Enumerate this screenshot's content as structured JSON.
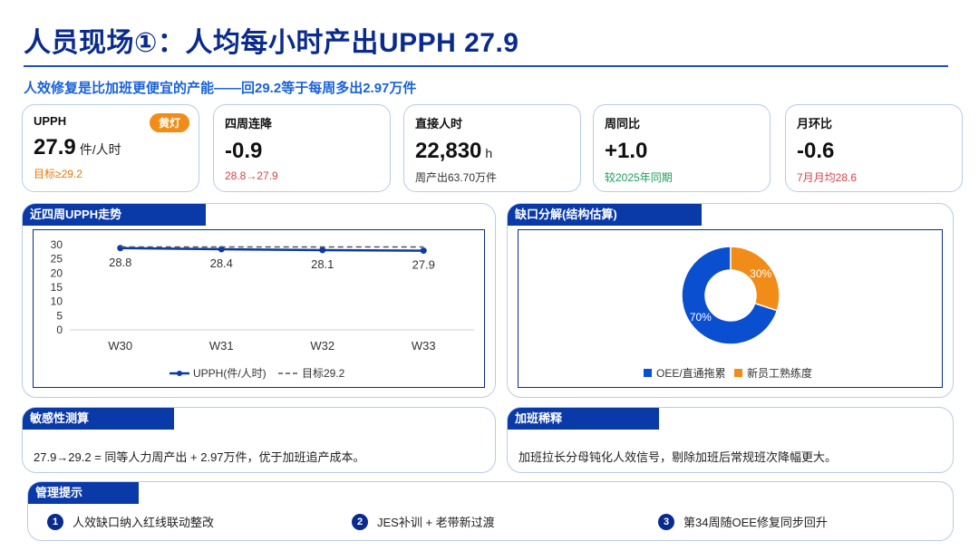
{
  "header": {
    "title": "人员现场①：人均每小时产出UPPH 27.9",
    "subtitle": "人效修复是比加班更便宜的产能——回29.2等于每周多出2.97万件"
  },
  "kpis": [
    {
      "label": "UPPH",
      "value": "27.9",
      "unit": "件/人时",
      "sub": "目标≥29.2",
      "sub_color": "#e07b10",
      "badge": "黄灯",
      "badge_color": "#f28c18"
    },
    {
      "label": "四周连降",
      "value": "-0.9",
      "unit": "",
      "sub": "28.8→27.9",
      "sub_color": "#d0454c"
    },
    {
      "label": "直接人时",
      "value": "22,830",
      "unit": "h",
      "sub": "周产出63.70万件",
      "sub_color": "#333333"
    },
    {
      "label": "周同比",
      "value": "+1.0",
      "unit": "",
      "sub": "较2025年同期",
      "sub_color": "#1e9b5a"
    },
    {
      "label": "月环比",
      "value": "-0.6",
      "unit": "",
      "sub": "7月月均28.6",
      "sub_color": "#d0454c"
    }
  ],
  "trend_panel": {
    "title": "近四周UPPH走势"
  },
  "donut_panel": {
    "title": "缺口分解(结构估算)"
  },
  "sensitivity": {
    "title": "敏感性测算",
    "text": "27.9→29.2 = 同等人力周产出 + 2.97万件，优于加班追产成本。"
  },
  "overtime": {
    "title": "加班稀释",
    "text": "加班拉长分母钝化人效信号，剔除加班后常规班次降幅更大。"
  },
  "tips": {
    "title": "管理提示",
    "items": [
      {
        "num": "1",
        "text": "人效缺口纳入红线联动整改"
      },
      {
        "num": "2",
        "text": "JES补训 + 老带新过渡"
      },
      {
        "num": "3",
        "text": "第34周随OEE修复同步回升"
      }
    ]
  },
  "colors": {
    "primary": "#0a2b8e",
    "accent": "#1a62d6",
    "orange": "#f28c18",
    "donut_blue": "#0a4fd0"
  },
  "chart_data": [
    {
      "type": "line",
      "title": "近四周UPPH走势",
      "categories": [
        "W30",
        "W31",
        "W32",
        "W33"
      ],
      "series": [
        {
          "name": "UPPH(件/人时)",
          "values": [
            28.8,
            28.4,
            28.1,
            27.9
          ],
          "color": "#0a3aa8",
          "style": "solid"
        },
        {
          "name": "目标29.2",
          "values": [
            29.2,
            29.2,
            29.2,
            29.2
          ],
          "color": "#555555",
          "style": "dashed"
        }
      ],
      "ylim": [
        0,
        30
      ],
      "yticks": [
        "0",
        "5",
        "10",
        "15",
        "20",
        "25",
        "30"
      ],
      "data_labels": [
        "28.8",
        "28.4",
        "28.1",
        "27.9"
      ],
      "legend_position": "bottom",
      "grid": false
    },
    {
      "type": "pie",
      "title": "缺口分解(结构估算)",
      "donut": true,
      "labels": [
        "OEE/直通拖累",
        "新员工熟练度"
      ],
      "values": [
        70,
        30
      ],
      "value_labels": [
        "70%",
        "30%"
      ],
      "colors": [
        "#0a4fd0",
        "#f28c18"
      ],
      "legend_position": "bottom"
    }
  ]
}
